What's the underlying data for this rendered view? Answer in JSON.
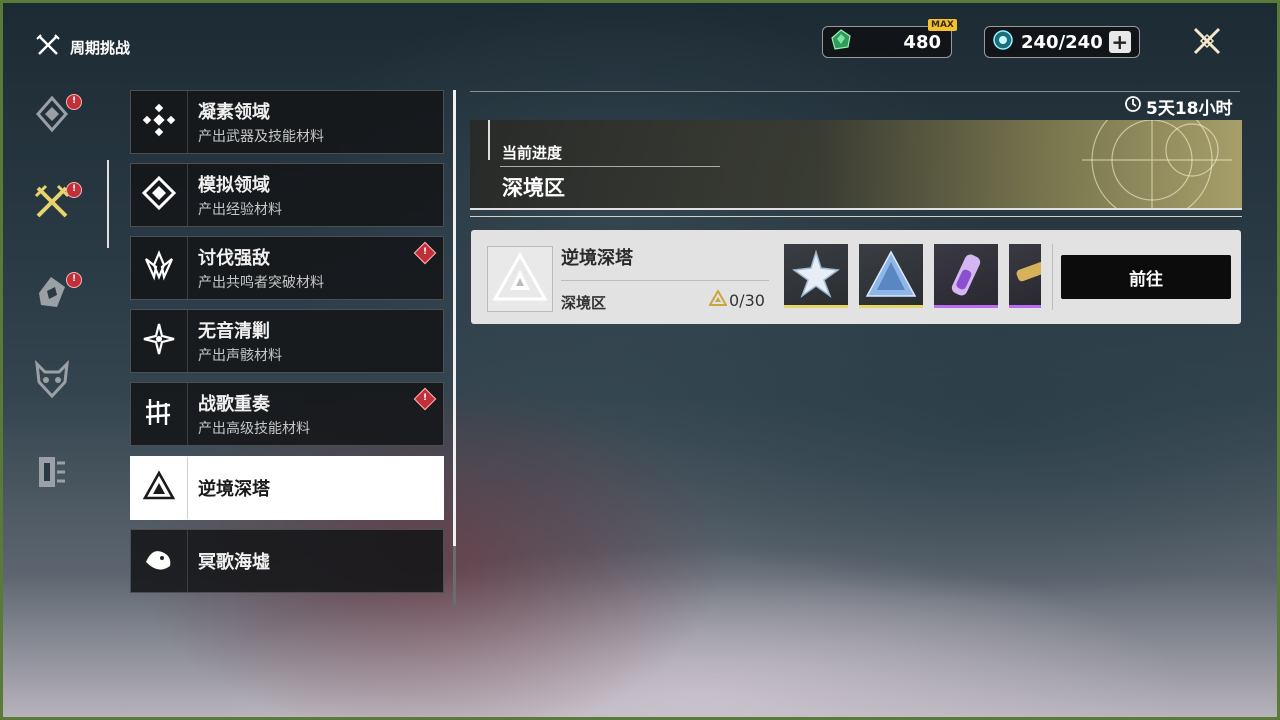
{
  "header": {
    "title": "周期挑战"
  },
  "currencies": [
    {
      "value": "480",
      "badge": "MAX"
    },
    {
      "value": "240/240",
      "plus": "+"
    }
  ],
  "list": [
    {
      "title": "凝素领域",
      "subtitle": "产出武器及技能材料"
    },
    {
      "title": "模拟领域",
      "subtitle": "产出经验材料"
    },
    {
      "title": "讨伐强敌",
      "subtitle": "产出共鸣者突破材料"
    },
    {
      "title": "无音清剿",
      "subtitle": "产出声骸材料"
    },
    {
      "title": "战歌重奏",
      "subtitle": "产出高级技能材料"
    },
    {
      "title": "逆境深塔",
      "subtitle": ""
    },
    {
      "title": "冥歌海墟",
      "subtitle": ""
    }
  ],
  "panel": {
    "timer": "5天18小时",
    "progress_label": "当前进度",
    "progress_area": "深境区"
  },
  "card": {
    "name": "逆境深塔",
    "zone": "深境区",
    "count": "0/30",
    "go_label": "前往"
  },
  "colors": {
    "accent_gold": "#e8d46a",
    "accent_purple": "#b96cf0",
    "alert_red": "#c0303a"
  }
}
